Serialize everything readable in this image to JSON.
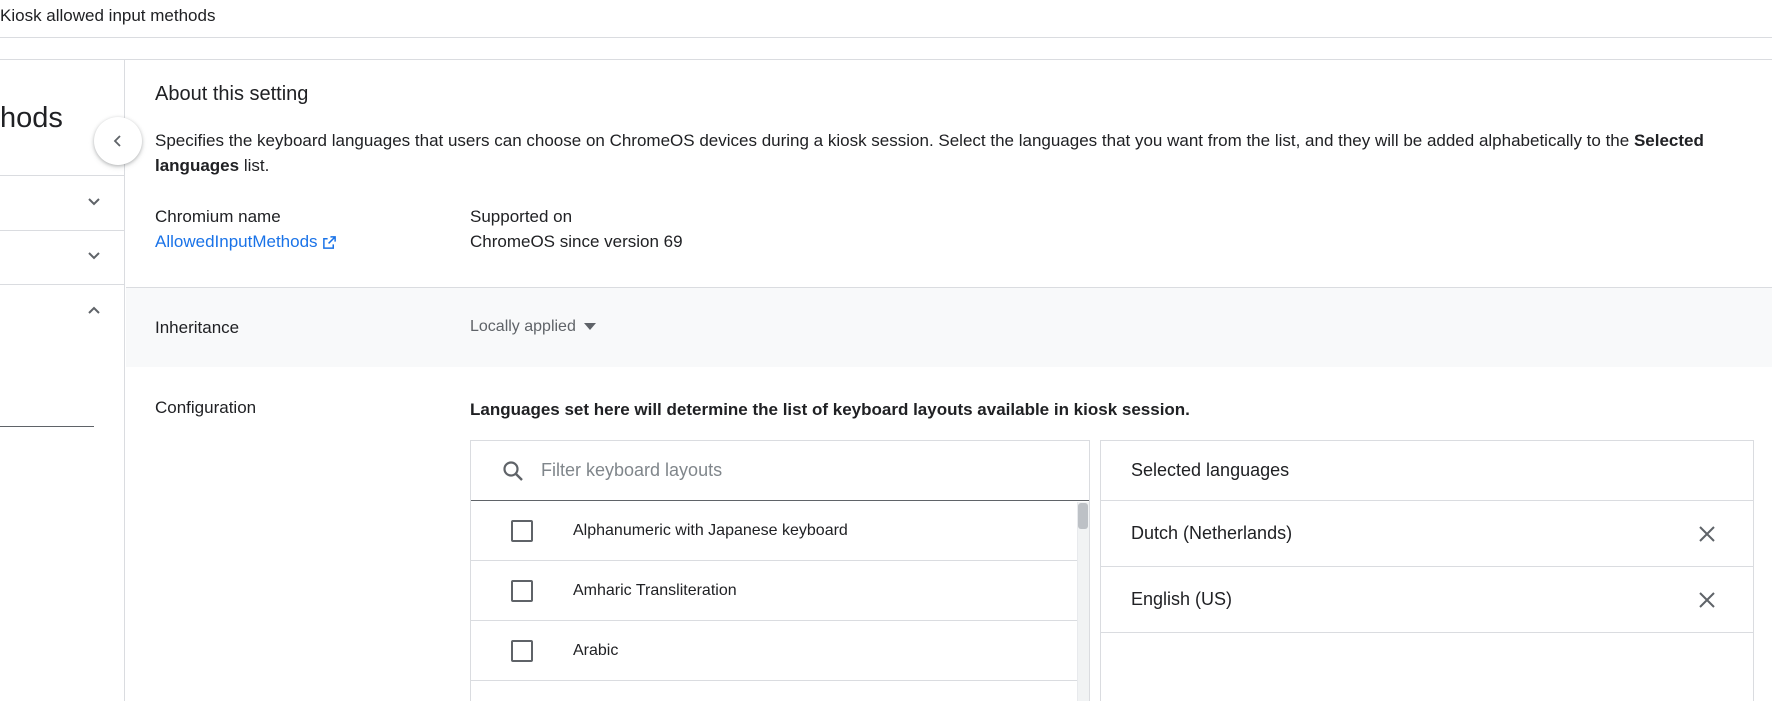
{
  "page": {
    "title": "Kiosk allowed input methods"
  },
  "sidebar": {
    "heading_fragment": "hods"
  },
  "about": {
    "title": "About this setting",
    "description": "Specifies the keyboard languages that users can choose on ChromeOS devices during a kiosk session. Select the languages that you want from the list, and they will be added alphabetically to the ",
    "description_bold": "Selected languages",
    "description_end": " list.",
    "chromium_name_label": "Chromium name",
    "chromium_name_value": "AllowedInputMethods",
    "supported_on_label": "Supported on",
    "supported_on_value": "ChromeOS since version 69"
  },
  "inheritance": {
    "label": "Inheritance",
    "value": "Locally applied"
  },
  "configuration": {
    "label": "Configuration",
    "note": "Languages set here will determine the list of keyboard layouts available in kiosk session."
  },
  "layouts": {
    "search_placeholder": "Filter keyboard layouts",
    "items": [
      {
        "label": "Alphanumeric with Japanese keyboard",
        "checked": false
      },
      {
        "label": "Amharic Transliteration",
        "checked": false
      },
      {
        "label": "Arabic",
        "checked": false
      }
    ]
  },
  "selected_languages": {
    "header": "Selected languages",
    "items": [
      {
        "label": "Dutch (Netherlands)"
      },
      {
        "label": "English (US)"
      }
    ]
  },
  "colors": {
    "link": "#1a73e8",
    "divider": "#dadce0",
    "inherit_bg": "#f8f9fa"
  }
}
